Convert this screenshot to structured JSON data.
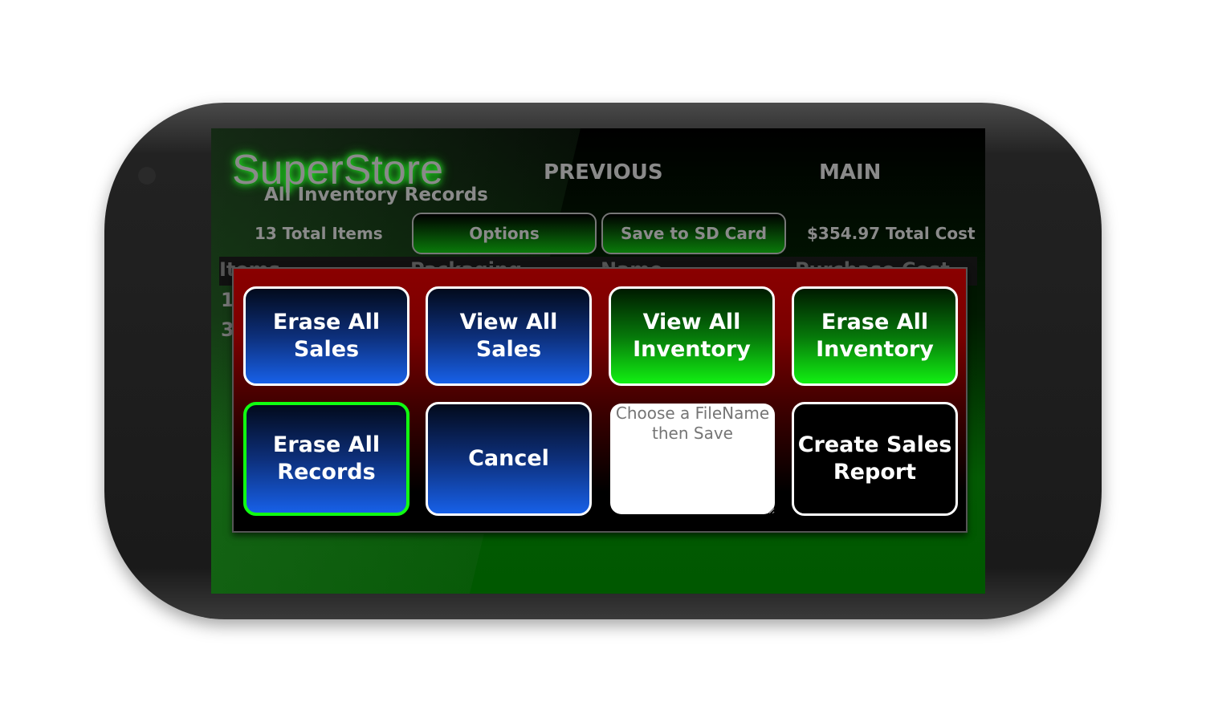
{
  "app": {
    "title": "SuperStore",
    "subtitle": "All Inventory Records"
  },
  "nav": {
    "previous": "PREVIOUS",
    "main": "MAIN"
  },
  "toolbar": {
    "total_items": "13 Total Items",
    "options": "Options",
    "save_sd": "Save to SD Card",
    "total_cost": "$354.97 Total Cost"
  },
  "table": {
    "headers": [
      "Items",
      "Packaging",
      "Name",
      "Purchase Cost"
    ],
    "rows": [
      [
        "1"
      ],
      [
        "3"
      ]
    ]
  },
  "dialog": {
    "buttons": [
      {
        "line1": "Erase All",
        "line2": "Sales",
        "style": "blue"
      },
      {
        "line1": "View All",
        "line2": "Sales",
        "style": "blue"
      },
      {
        "line1": "View All",
        "line2": "Inventory",
        "style": "green"
      },
      {
        "line1": "Erase All",
        "line2": "Inventory",
        "style": "green"
      },
      {
        "line1": "Erase All",
        "line2": "Records",
        "style": "blue",
        "selected": true
      },
      {
        "line1": "Cancel",
        "style": "blue"
      },
      {
        "line1": "Create Sales",
        "line2": "Report",
        "style": "black"
      }
    ],
    "filename": {
      "value": "",
      "placeholder": "Choose a FileName then Save"
    }
  },
  "colors": {
    "blue": "#1760e8",
    "green": "#12f012",
    "red": "#8a0000",
    "screen_green": "#005800",
    "focus": "#11ff11"
  }
}
